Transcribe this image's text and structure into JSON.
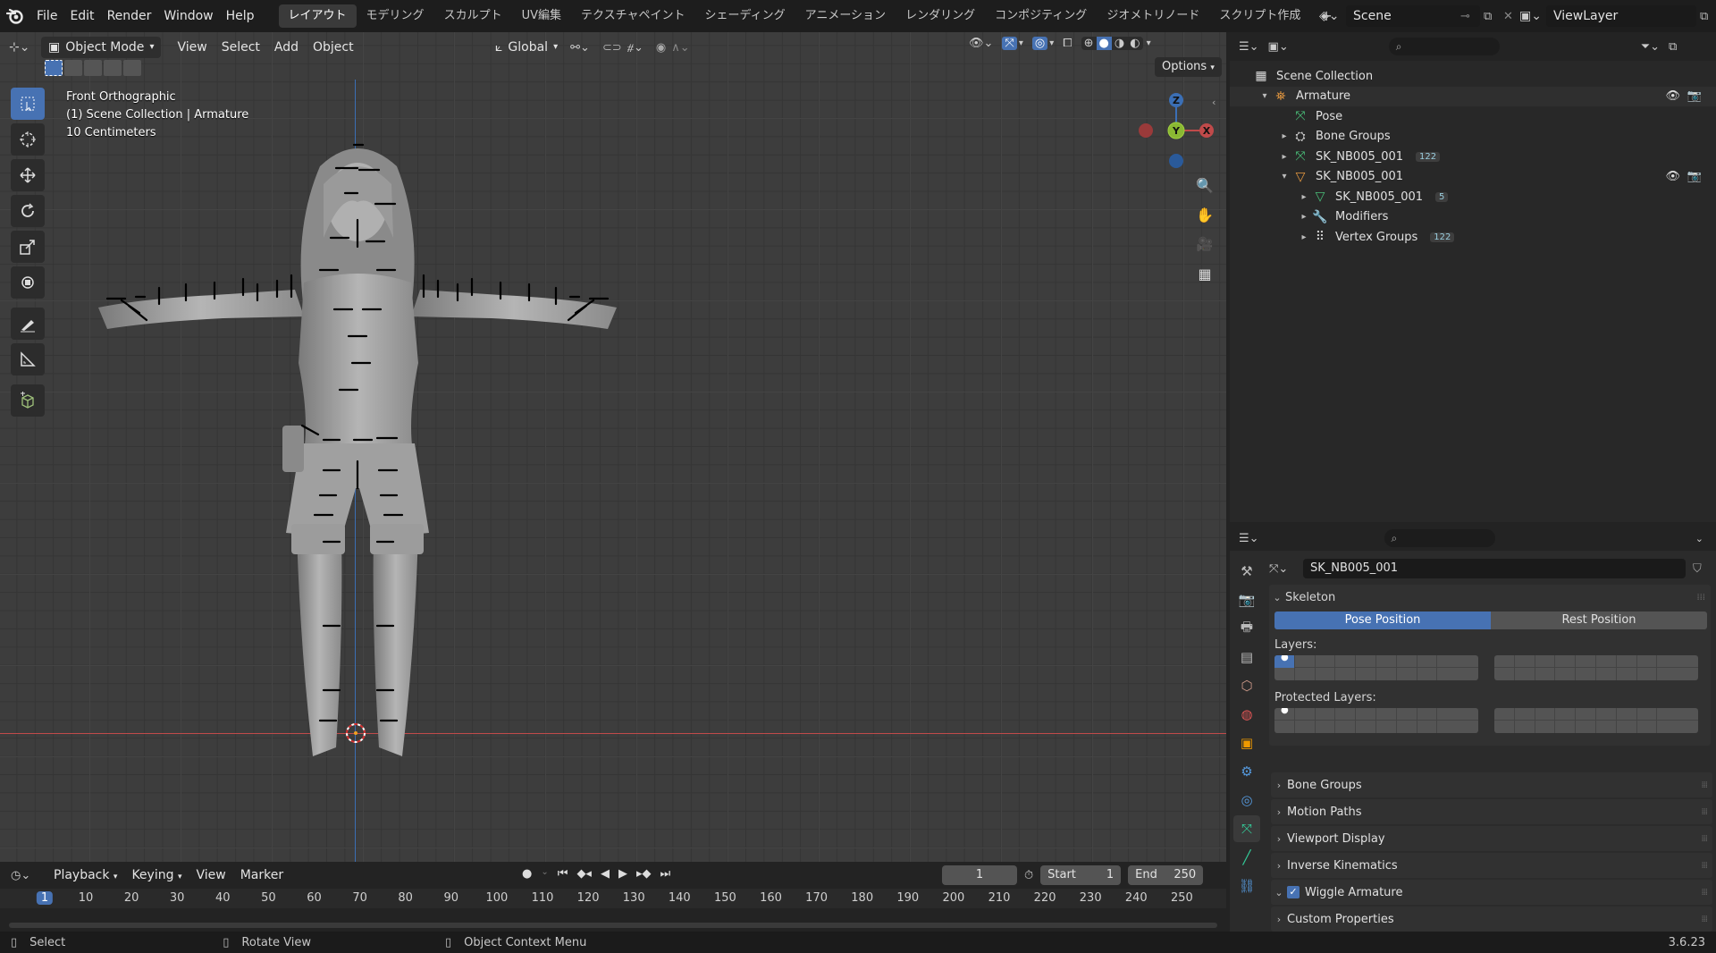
{
  "topbar": {
    "menus": [
      "File",
      "Edit",
      "Render",
      "Window",
      "Help"
    ],
    "workspaces": [
      "レイアウト",
      "モデリング",
      "スカルプト",
      "UV編集",
      "テクスチャペイント",
      "シェーディング",
      "アニメーション",
      "レンダリング",
      "コンポジティング",
      "ジオメトリノード",
      "スクリプト作成"
    ],
    "active_workspace": "レイアウト",
    "add_workspace": "+",
    "scene": "Scene",
    "view_layer": "ViewLayer"
  },
  "viewport": {
    "mode": "Object Mode",
    "menus": [
      "View",
      "Select",
      "Add",
      "Object"
    ],
    "transform_orientation": "Global",
    "options": "Options",
    "overlay_info": [
      "Front Orthographic",
      "(1) Scene Collection | Armature",
      "10 Centimeters"
    ],
    "gizmo_axes": {
      "x": "X",
      "y": "Y",
      "z": "Z"
    },
    "tools": [
      "select-box-icon",
      "cursor-icon",
      "move-icon",
      "rotate-icon",
      "scale-icon",
      "transform-icon",
      "annotate-icon",
      "measure-icon",
      "add-cube-icon"
    ],
    "colors": {
      "x_axis": "#c04a4a",
      "z_axis": "#3b6fb5",
      "selection": "#4772b3"
    }
  },
  "outliner": {
    "search_placeholder": "",
    "rows": [
      {
        "label": "Scene Collection",
        "icon": "collection-icon",
        "depth": 0,
        "arrow": ""
      },
      {
        "label": "Armature",
        "icon": "armature-object-icon",
        "depth": 1,
        "arrow": "▾",
        "visible": true
      },
      {
        "label": "Pose",
        "icon": "pose-icon",
        "depth": 2,
        "arrow": ""
      },
      {
        "label": "Bone Groups",
        "icon": "bone-groups-icon",
        "depth": 2,
        "arrow": "▸"
      },
      {
        "label": "SK_NB005_001",
        "icon": "armature-data-icon",
        "depth": 2,
        "arrow": "▸",
        "badge": "122"
      },
      {
        "label": "SK_NB005_001",
        "icon": "mesh-object-icon",
        "depth": 2,
        "arrow": "▾",
        "visible": true
      },
      {
        "label": "SK_NB005_001",
        "icon": "mesh-data-icon",
        "depth": 3,
        "arrow": "▸",
        "badge": "5"
      },
      {
        "label": "Modifiers",
        "icon": "modifier-icon",
        "depth": 3,
        "arrow": "▸"
      },
      {
        "label": "Vertex Groups",
        "icon": "vertex-groups-icon",
        "depth": 3,
        "arrow": "▸",
        "badge": "122"
      }
    ]
  },
  "properties": {
    "datablock": "SK_NB005_001",
    "skeleton_label": "Skeleton",
    "pose_position": "Pose Position",
    "rest_position": "Rest Position",
    "layers_label": "Layers:",
    "protected_layers_label": "Protected Layers:",
    "panels": [
      "Bone Groups",
      "Motion Paths",
      "Viewport Display",
      "Inverse Kinematics",
      "Wiggle Armature",
      "Custom Properties"
    ],
    "wiggle_checked": true
  },
  "timeline": {
    "menus": [
      "Playback",
      "Keying",
      "View",
      "Marker"
    ],
    "current_frame": "1",
    "start_label": "Start",
    "start_value": "1",
    "end_label": "End",
    "end_value": "250",
    "ruler": [
      "1",
      "10",
      "20",
      "30",
      "40",
      "50",
      "60",
      "70",
      "80",
      "90",
      "100",
      "110",
      "120",
      "130",
      "140",
      "150",
      "160",
      "170",
      "180",
      "190",
      "200",
      "210",
      "220",
      "230",
      "240",
      "250"
    ]
  },
  "statusbar": {
    "hints": [
      "Select",
      "Rotate View",
      "Object Context Menu"
    ],
    "version": "3.6.23"
  }
}
